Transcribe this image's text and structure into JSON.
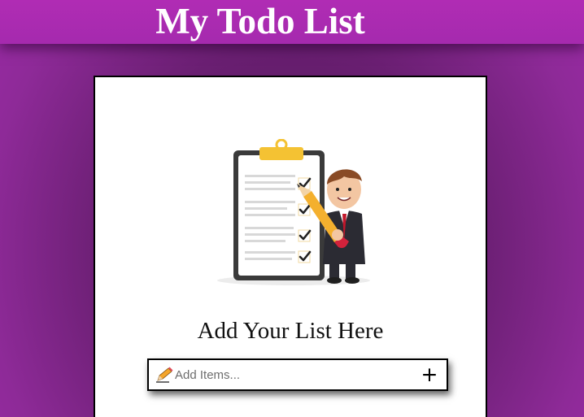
{
  "header": {
    "title": "My Todo List"
  },
  "card": {
    "illustration_icon": "clipboard-checklist-person-illustration",
    "subtitle": "Add Your List Here"
  },
  "add_item": {
    "placeholder": "Add Items...",
    "value": "",
    "leading_icon": "pencil-icon",
    "button_icon": "plus-icon",
    "button_label": "+"
  },
  "colors": {
    "accent": "#a52aae",
    "background_dark": "#4a1550"
  }
}
